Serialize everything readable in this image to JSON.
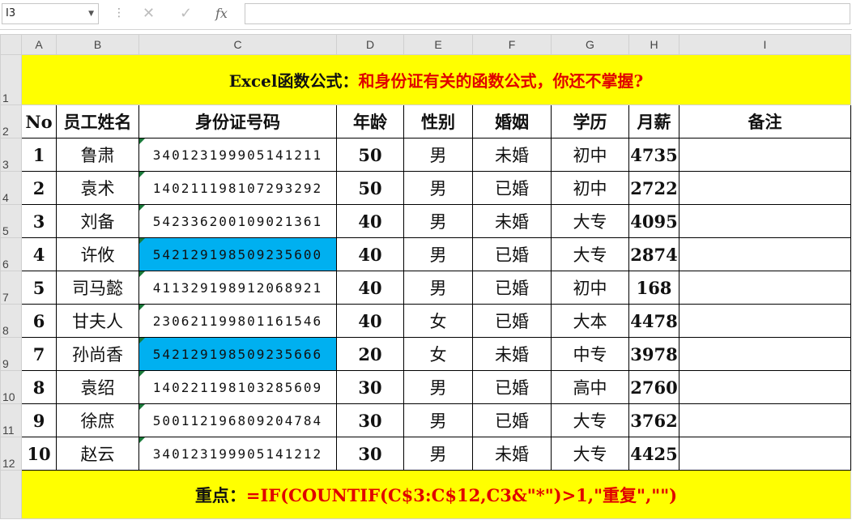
{
  "formula_bar": {
    "name_box": "I3",
    "fx_label": "fx",
    "formula": ""
  },
  "columns": [
    "A",
    "B",
    "C",
    "D",
    "E",
    "F",
    "G",
    "H",
    "I"
  ],
  "rows": [
    "1",
    "2",
    "3",
    "4",
    "5",
    "6",
    "7",
    "8",
    "9",
    "10",
    "11",
    "12"
  ],
  "title": {
    "prefix": "Excel函数公式：",
    "highlight": "和身份证有关的函数公式，你还不掌握?"
  },
  "headers": [
    "No",
    "员工姓名",
    "身份证号码",
    "年龄",
    "性别",
    "婚姻",
    "学历",
    "月薪",
    "备注"
  ],
  "records": [
    {
      "no": "1",
      "name": "鲁肃",
      "id": "340123199905141211",
      "age": "50",
      "gender": "男",
      "marriage": "未婚",
      "edu": "初中",
      "salary": "4735",
      "note": ""
    },
    {
      "no": "2",
      "name": "袁术",
      "id": "140211198107293292",
      "age": "50",
      "gender": "男",
      "marriage": "已婚",
      "edu": "初中",
      "salary": "2722",
      "note": ""
    },
    {
      "no": "3",
      "name": "刘备",
      "id": "542336200109021361",
      "age": "40",
      "gender": "男",
      "marriage": "未婚",
      "edu": "大专",
      "salary": "4095",
      "note": ""
    },
    {
      "no": "4",
      "name": "许攸",
      "id": "542129198509235600",
      "age": "40",
      "gender": "男",
      "marriage": "已婚",
      "edu": "大专",
      "salary": "2874",
      "note": ""
    },
    {
      "no": "5",
      "name": "司马懿",
      "id": "411329198912068921",
      "age": "40",
      "gender": "男",
      "marriage": "已婚",
      "edu": "初中",
      "salary": "168",
      "note": ""
    },
    {
      "no": "6",
      "name": "甘夫人",
      "id": "230621199801161546",
      "age": "40",
      "gender": "女",
      "marriage": "已婚",
      "edu": "大本",
      "salary": "4478",
      "note": ""
    },
    {
      "no": "7",
      "name": "孙尚香",
      "id": "542129198509235666",
      "age": "20",
      "gender": "女",
      "marriage": "未婚",
      "edu": "中专",
      "salary": "3978",
      "note": ""
    },
    {
      "no": "8",
      "name": "袁绍",
      "id": "140221198103285609",
      "age": "30",
      "gender": "男",
      "marriage": "已婚",
      "edu": "高中",
      "salary": "2760",
      "note": ""
    },
    {
      "no": "9",
      "name": "徐庶",
      "id": "500112196809204784",
      "age": "30",
      "gender": "男",
      "marriage": "已婚",
      "edu": "大专",
      "salary": "3762",
      "note": ""
    },
    {
      "no": "10",
      "name": "赵云",
      "id": "340123199905141212",
      "age": "30",
      "gender": "男",
      "marriage": "未婚",
      "edu": "大专",
      "salary": "4425",
      "note": ""
    }
  ],
  "highlight_color": "#00b0f0",
  "footer": {
    "label": "重点：",
    "formula": "=IF(COUNTIF(C$3:C$12,C3&\"*\")>1,\"重复\",\"\")"
  }
}
